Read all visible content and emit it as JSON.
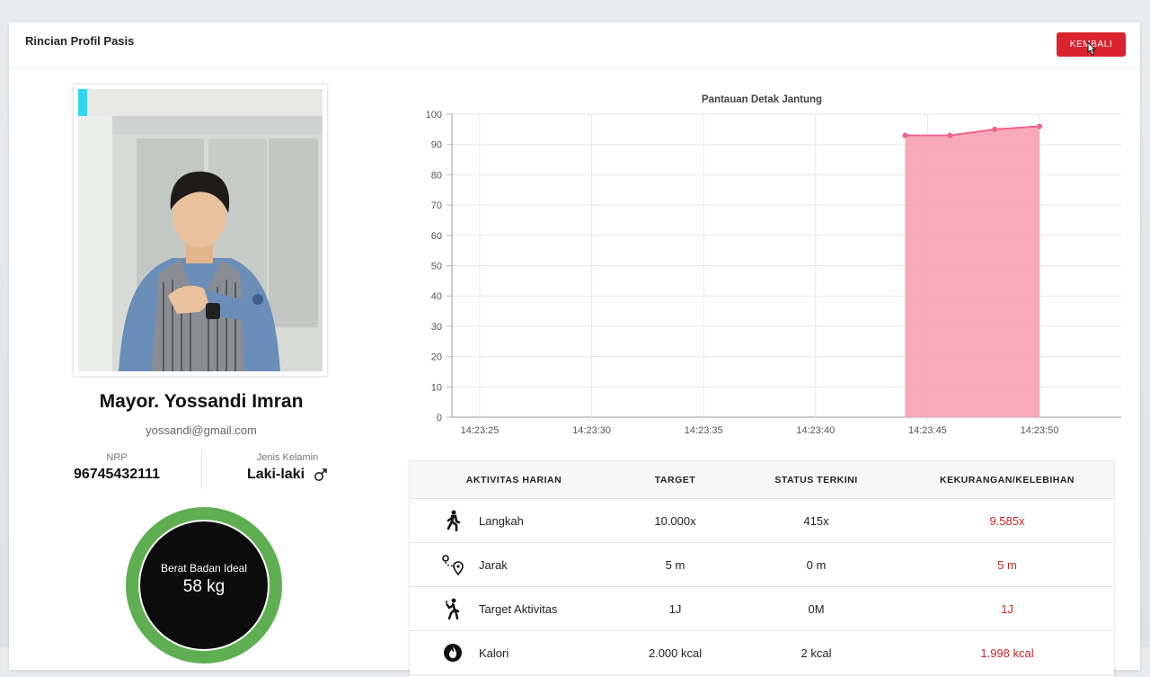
{
  "header": {
    "title": "Rincian Profil Pasis",
    "back_label": "KEMBALI"
  },
  "profile": {
    "name": "Mayor. Yossandi Imran",
    "email": "yossandi@gmail.com",
    "nrp_label": "NRP",
    "nrp_value": "96745432111",
    "gender_label": "Jenis Kelamin",
    "gender_value": "Laki-laki",
    "gender_icon": "male-symbol-icon",
    "ideal_weight_label": "Berat Badan Ideal",
    "ideal_weight_value": "58 kg",
    "gauge_color": "#4caf50"
  },
  "chart_data": {
    "type": "area",
    "title": "Pantauan Detak Jantung",
    "x": [
      "14:23:25",
      "14:23:30",
      "14:23:35",
      "14:23:40",
      "14:23:45",
      "14:23:50"
    ],
    "points": [
      {
        "x": "14:23:44",
        "y": 93
      },
      {
        "x": "14:23:46",
        "y": 93
      },
      {
        "x": "14:23:48",
        "y": 95
      },
      {
        "x": "14:23:50",
        "y": 96
      }
    ],
    "ylim": [
      0,
      100
    ],
    "yticks": [
      0,
      10,
      20,
      30,
      40,
      50,
      60,
      70,
      80,
      90,
      100
    ],
    "grid": true,
    "color": "#f0638a",
    "fill": "#f7a1b4"
  },
  "activity_table": {
    "headers": [
      "AKTIVITAS HARIAN",
      "TARGET",
      "STATUS TERKINI",
      "KEKURANGAN/KELEBIHAN"
    ],
    "rows": [
      {
        "icon": "walking-icon",
        "activity": "Langkah",
        "target": "10.000x",
        "status": "415x",
        "diff": "9.585x"
      },
      {
        "icon": "route-pin-icon",
        "activity": "Jarak",
        "target": "5 m",
        "status": "0 m",
        "diff": "5 m"
      },
      {
        "icon": "running-target-icon",
        "activity": "Target Aktivitas",
        "target": "1J",
        "status": "0M",
        "diff": "1J"
      },
      {
        "icon": "flame-icon",
        "activity": "Kalori",
        "target": "2.000 kcal",
        "status": "2 kcal",
        "diff": "1.998 kcal"
      }
    ],
    "diff_color": "#c62828"
  }
}
